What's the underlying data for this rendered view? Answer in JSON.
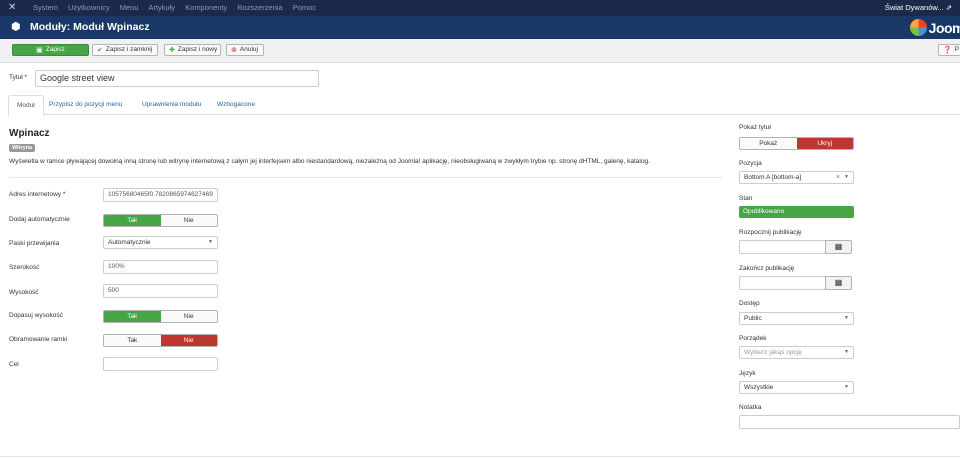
{
  "navbar": {
    "menu": [
      "System",
      "Użytkownicy",
      "Menu",
      "Artykuły",
      "Komponenty",
      "Rozszerzenia",
      "Pomoc"
    ],
    "site_name": "Świat Dywanów... ⇗"
  },
  "header": {
    "title": "Moduły: Moduł Wpinacz",
    "brand": "Joom"
  },
  "toolbar": {
    "save": "Zapisz",
    "save_close": "Zapisz i zamknij",
    "save_new": "Zapisz i nowy",
    "cancel": "Anuluj",
    "help": "P"
  },
  "title_field": {
    "label": "Tytuł *",
    "value": "Google street view"
  },
  "tabs": [
    "Moduł",
    "Przypisz do pozycji menu",
    "Uprawnienia modułu",
    "Wzbogacone"
  ],
  "module": {
    "name": "Wpinacz",
    "badge": "Witryna",
    "description": "Wyświetla w ramce pływającej dowolną inną stronę lub witrynę internetową z całym jej interfejsem albo niestandardową, niezależną od Joomla! aplikację, nieobsługiwaną w zwykłym trybie np. stronę dHTML, galerię, katalog."
  },
  "fields": {
    "url": {
      "label": "Adres internetowy *",
      "value": "10575680465f0.7820865974627469"
    },
    "auto_add": {
      "label": "Dodaj automatycznie",
      "yes": "Tak",
      "no": "Nie"
    },
    "scrollbars": {
      "label": "Paski przewijania",
      "value": "Automatycznie"
    },
    "width": {
      "label": "Szerokość",
      "value": "100%"
    },
    "height": {
      "label": "Wysokość",
      "value": "500"
    },
    "auto_height": {
      "label": "Dopasuj wysokość",
      "yes": "Tak",
      "no": "Nie"
    },
    "frame_border": {
      "label": "Obramowanie ramki",
      "yes": "Tak",
      "no": "Nie"
    },
    "target": {
      "label": "Cel",
      "value": ""
    }
  },
  "sidebar": {
    "show_title": {
      "label": "Pokaż tytuł",
      "show": "Pokaż",
      "hide": "Ukryj"
    },
    "position": {
      "label": "Pozycja",
      "value": "Bottom A [bottom-a]",
      "clear": "×"
    },
    "state": {
      "label": "Stan",
      "value": "Opublikowano"
    },
    "publish_up": {
      "label": "Rozpocznij publikację",
      "value": ""
    },
    "publish_down": {
      "label": "Zakończ publikację",
      "value": ""
    },
    "access": {
      "label": "Dostęp",
      "value": "Public"
    },
    "ordering": {
      "label": "Porządek",
      "placeholder": "Wybierz jakąś opcję"
    },
    "language": {
      "label": "Język",
      "value": "Wszystkie"
    },
    "note": {
      "label": "Notatka",
      "value": ""
    }
  },
  "colors": {
    "navbar": "#1b2a4a",
    "header": "#1a3867",
    "success": "#46a546",
    "danger": "#bd362f",
    "link": "#2a6496"
  }
}
